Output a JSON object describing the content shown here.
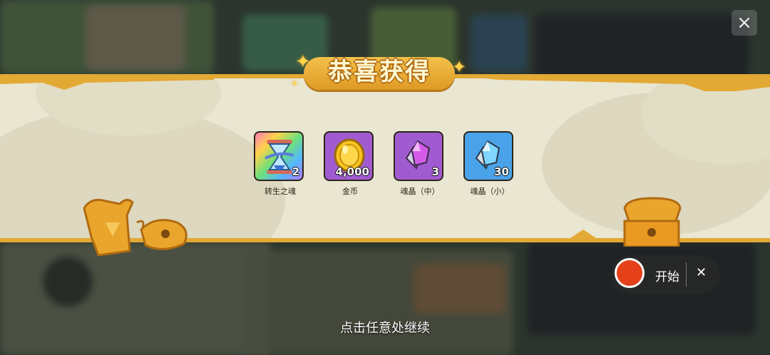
{
  "banner": {
    "title": "恭喜获得"
  },
  "rewards": [
    {
      "name": "转生之魂",
      "qty": "2",
      "icon": "hourglass-icon",
      "bg": "rainbow"
    },
    {
      "name": "金币",
      "qty": "4,000",
      "icon": "gold-coin-icon",
      "bg": "#a15bd1"
    },
    {
      "name": "魂晶（中）",
      "qty": "3",
      "icon": "purple-crystal-icon",
      "bg": "#a15bd1"
    },
    {
      "name": "魂晶（小）",
      "qty": "30",
      "icon": "blue-crystal-icon",
      "bg": "#4aa3e8"
    }
  ],
  "recorder": {
    "start_label": "开始",
    "close_symbol": "✕"
  },
  "hint": {
    "continue_text": "点击任意处继续"
  },
  "colors": {
    "banner_bg": "#e9e6d2",
    "banner_trim": "#e3a935",
    "title_plate": "#eeb23a",
    "record_red": "#e4401a"
  }
}
